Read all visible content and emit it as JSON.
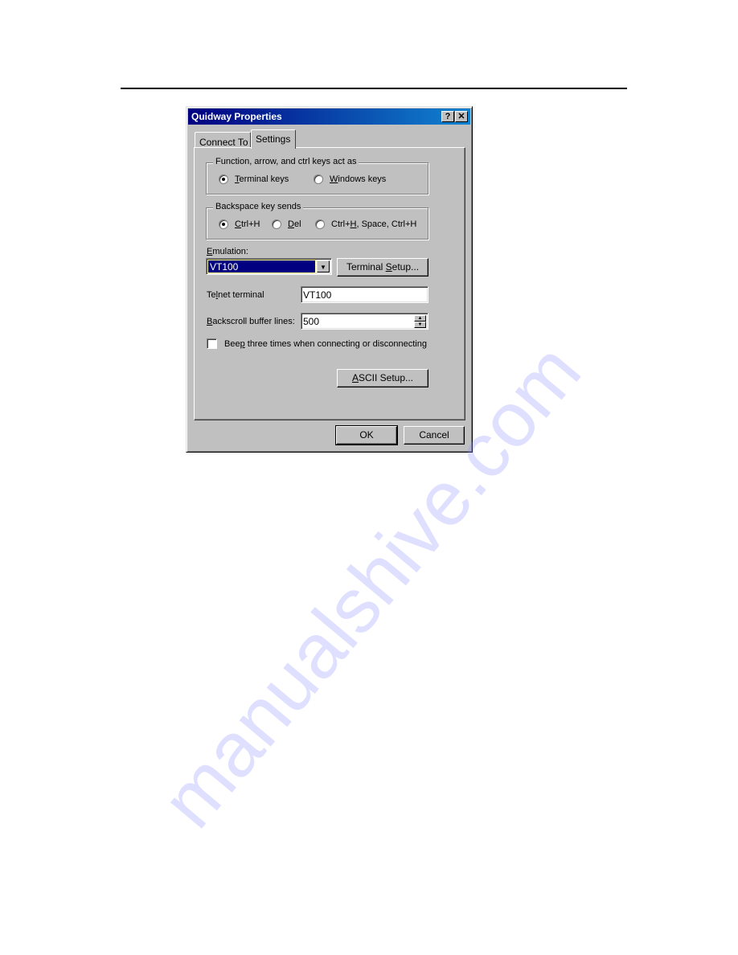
{
  "document": {
    "watermark": "manualshive.com"
  },
  "dialog": {
    "title": "Quidway Properties",
    "help_button": "?",
    "close_button": "✕",
    "tabs": [
      {
        "label": "Connect To",
        "active": false
      },
      {
        "label": "Settings",
        "active": true
      }
    ],
    "keys_group": {
      "label": "Function, arrow, and ctrl keys act as",
      "options": [
        {
          "pre": "",
          "mnemonic": "T",
          "post": "erminal keys",
          "selected": true
        },
        {
          "pre": "",
          "mnemonic": "W",
          "post": "indows keys",
          "selected": false
        }
      ]
    },
    "backspace_group": {
      "label": "Backspace key sends",
      "options": [
        {
          "pre": "",
          "mnemonic": "C",
          "post": "trl+H",
          "selected": true
        },
        {
          "pre": "",
          "mnemonic": "D",
          "post": "el",
          "selected": false
        },
        {
          "pre": "Ctrl+",
          "mnemonic": "H",
          "post": ", Space, Ctrl+H",
          "selected": false
        }
      ]
    },
    "emulation": {
      "label_mnemonic": "E",
      "label_rest": "mulation:",
      "value": "VT100",
      "setup_pre": "Terminal ",
      "setup_mnemonic": "S",
      "setup_post": "etup..."
    },
    "telnet": {
      "label_pre": "Te",
      "label_mnemonic": "l",
      "label_post": "net terminal",
      "value": "VT100"
    },
    "backscroll": {
      "label_mnemonic": "B",
      "label_rest": "ackscroll buffer lines:",
      "value": "500"
    },
    "beep": {
      "label_pre": "Bee",
      "label_mnemonic": "p",
      "label_post": " three times when connecting or disconnecting",
      "checked": false
    },
    "ascii_setup": {
      "mnemonic": "A",
      "rest": "SCII Setup..."
    },
    "ok_label": "OK",
    "cancel_label": "Cancel"
  }
}
